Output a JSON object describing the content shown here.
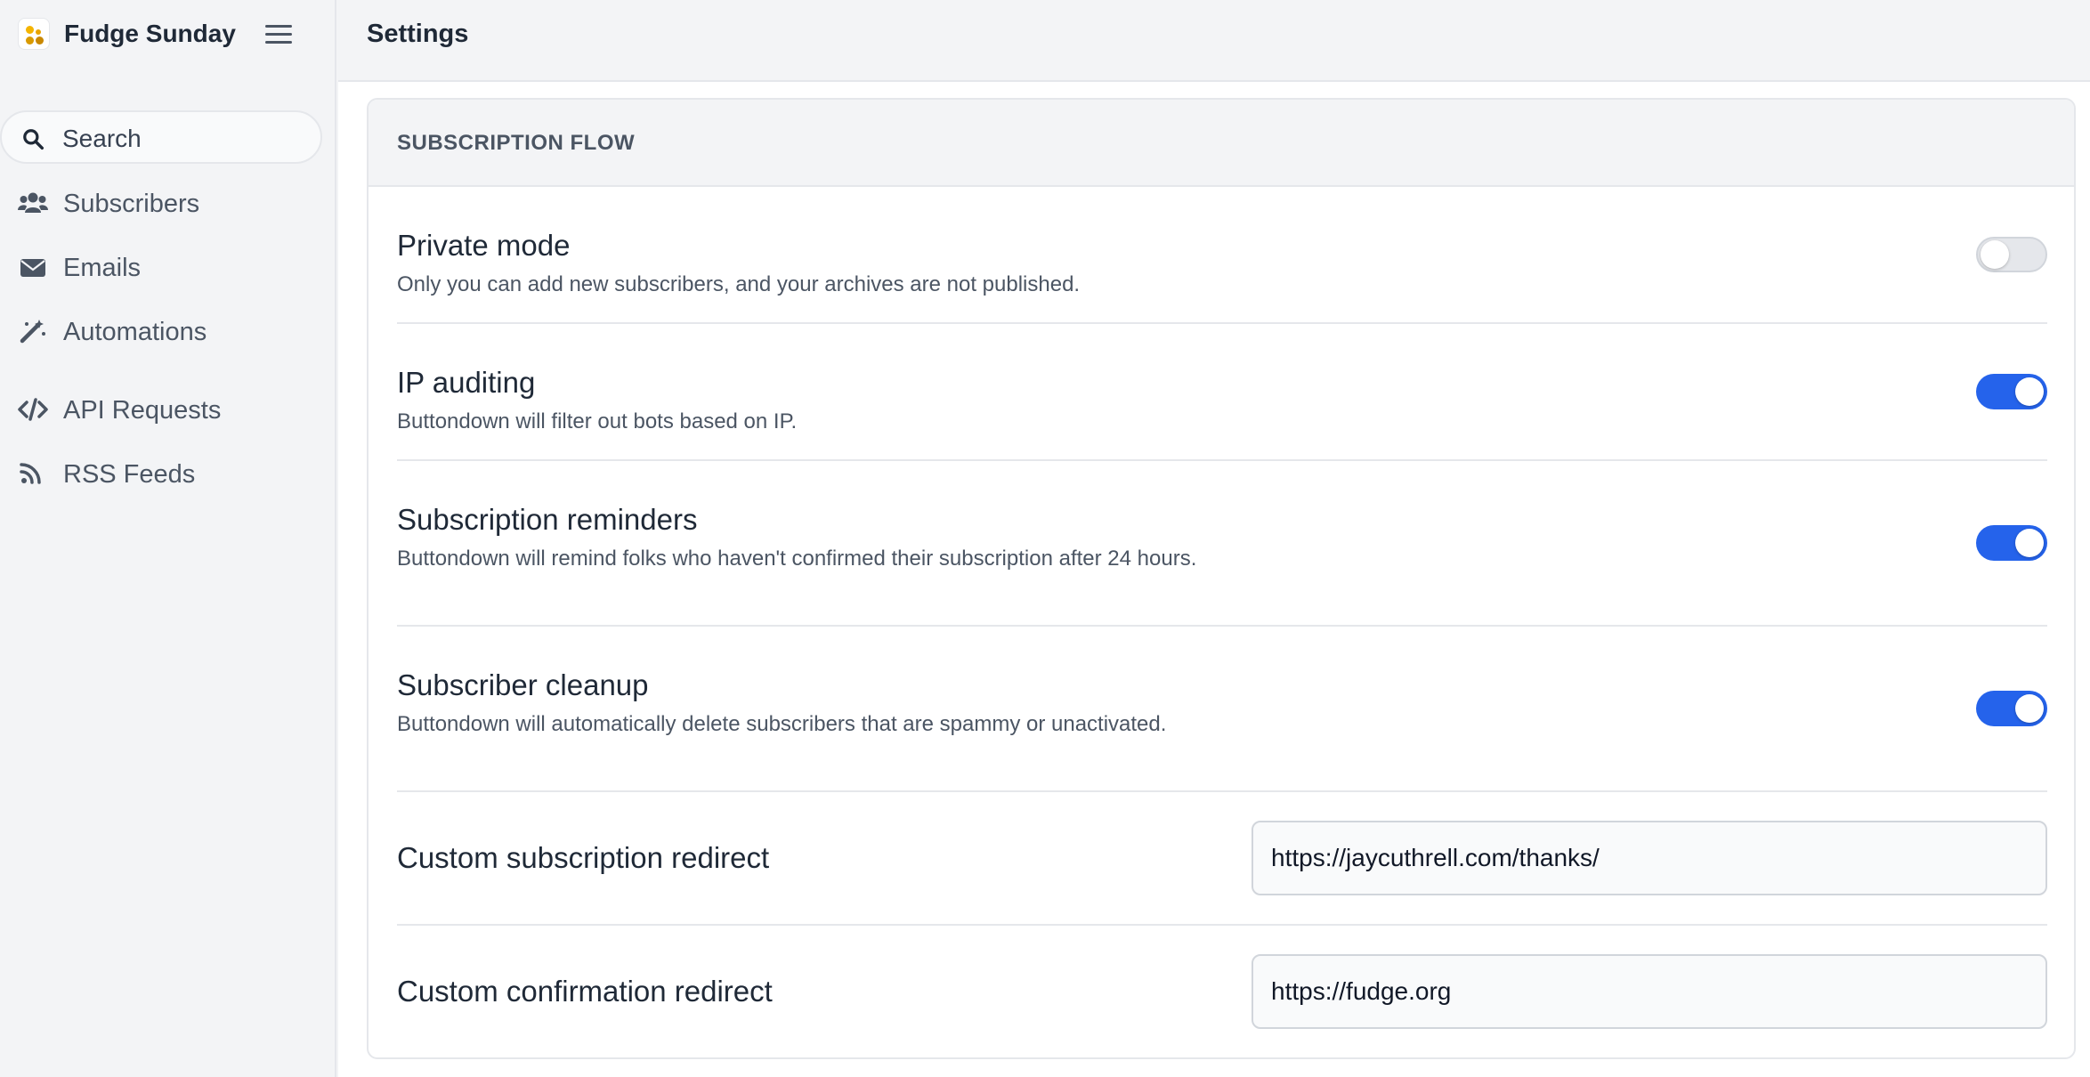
{
  "app": {
    "name": "Fudge Sunday"
  },
  "search": {
    "label": "Search"
  },
  "sidebar": {
    "items": [
      {
        "label": "Subscribers",
        "icon": "users-icon"
      },
      {
        "label": "Emails",
        "icon": "envelope-icon"
      },
      {
        "label": "Automations",
        "icon": "magic-wand-icon"
      },
      {
        "label": "API Requests",
        "icon": "code-icon"
      },
      {
        "label": "RSS Feeds",
        "icon": "rss-icon"
      }
    ]
  },
  "header": {
    "title": "Settings"
  },
  "section": {
    "title": "SUBSCRIPTION FLOW",
    "rows": [
      {
        "title": "Private mode",
        "description": "Only you can add new subscribers, and your archives are not published.",
        "enabled": false
      },
      {
        "title": "IP auditing",
        "description": "Buttondown will filter out bots based on IP.",
        "enabled": true
      },
      {
        "title": "Subscription reminders",
        "description": "Buttondown will remind folks who haven't confirmed their subscription after 24 hours.",
        "enabled": true
      },
      {
        "title": "Subscriber cleanup",
        "description": "Buttondown will automatically delete subscribers that are spammy or unactivated.",
        "enabled": true
      }
    ],
    "fields": [
      {
        "label": "Custom subscription redirect",
        "value": "https://jaycuthrell.com/thanks/"
      },
      {
        "label": "Custom confirmation redirect",
        "value": "https://fudge.org"
      }
    ]
  },
  "colors": {
    "accent": "#2563eb",
    "toggle_off": "#e5e7eb",
    "background": "#f3f4f6"
  }
}
